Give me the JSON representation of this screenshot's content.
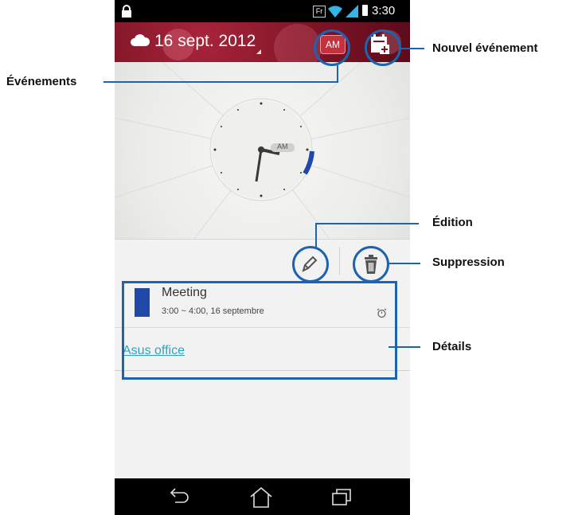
{
  "status_bar": {
    "keyboard_label": "Fr",
    "time": "3:30"
  },
  "header": {
    "date": "16 sept. 2012",
    "ampm": "AM"
  },
  "clock": {
    "ampm_badge": "AM",
    "progress_color": "#2048a8"
  },
  "event": {
    "title": "Meeting",
    "time": "3:00 ~ 4:00, 16 septembre",
    "color": "#2048a8",
    "location": "Asus office"
  },
  "callouts": {
    "events": "Événements",
    "new_event": "Nouvel événement",
    "edit": "Édition",
    "delete": "Suppression",
    "details": "Détails"
  },
  "colors": {
    "accent": "#1c63b0",
    "header": "#7d1426",
    "link": "#2ba3c8"
  }
}
